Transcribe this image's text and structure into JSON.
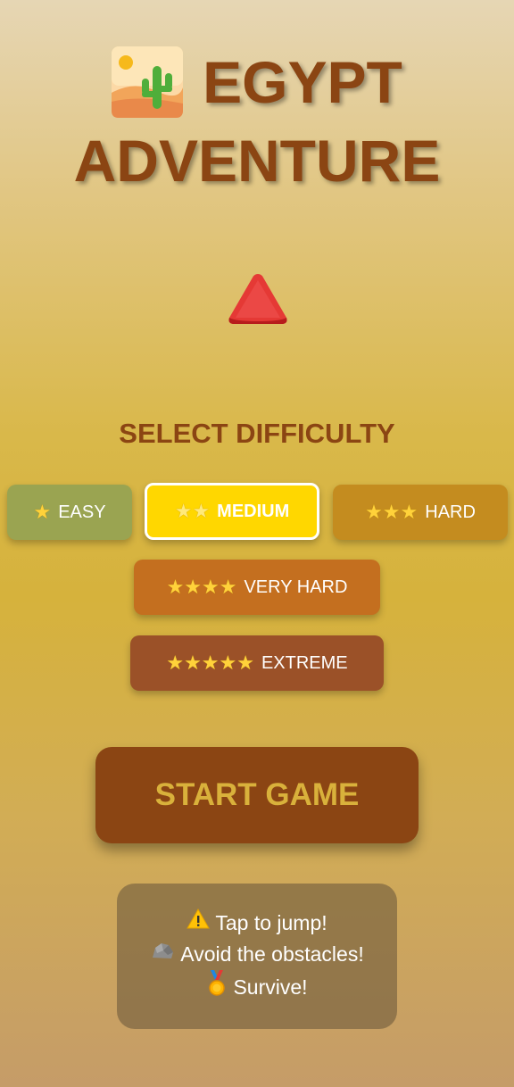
{
  "title": {
    "line1": "EGYPT",
    "line2": "ADVENTURE",
    "icon": "desert-icon"
  },
  "player": {
    "icon": "red-triangle-icon",
    "color": "#e53935"
  },
  "difficulty": {
    "label": "SELECT DIFFICULTY",
    "selected": "MEDIUM",
    "options": [
      {
        "stars": "★",
        "label": "EASY",
        "color": "#9aa451"
      },
      {
        "stars": "★★",
        "label": "MEDIUM",
        "color": "#ffd700"
      },
      {
        "stars": "★★★",
        "label": "HARD",
        "color": "#c48c1f"
      },
      {
        "stars": "★★★★",
        "label": "VERY HARD",
        "color": "#c46f1f"
      },
      {
        "stars": "★★★★★",
        "label": "EXTREME",
        "color": "#9b5128"
      }
    ]
  },
  "start": {
    "label": "START GAME"
  },
  "info": [
    {
      "icon": "warning-icon",
      "text": "Tap to jump!"
    },
    {
      "icon": "rock-icon",
      "text": "Avoid the obstacles!"
    },
    {
      "icon": "medal-icon",
      "text": "Survive!"
    }
  ],
  "colors": {
    "primary": "#8b4513",
    "accent": "#ffd700"
  }
}
